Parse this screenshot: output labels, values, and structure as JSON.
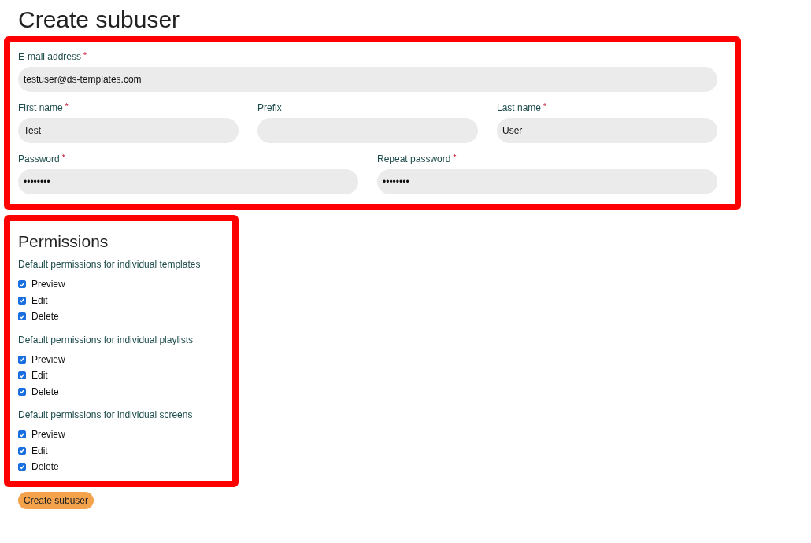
{
  "title": "Create subuser",
  "account": {
    "rows": [
      {
        "fields": [
          {
            "label": "E-mail address",
            "required_mark": "*",
            "value": "testuser@ds-templates.com"
          }
        ]
      },
      {
        "fields": [
          {
            "label": "First name",
            "required_mark": "*",
            "value": "Test"
          },
          {
            "label": "Prefix"
          },
          {
            "label": "Last name",
            "required_mark": "*",
            "value": "User"
          }
        ]
      },
      {
        "fields": [
          {
            "label": "Password",
            "required_mark": "*",
            "value": "••••••••"
          },
          {
            "label": "Repeat password",
            "required_mark": "*",
            "value": "••••••••"
          }
        ]
      }
    ]
  },
  "permissions": {
    "title": "Permissions",
    "groups": [
      {
        "title": "Default permissions for individual templates",
        "options": [
          {
            "label": "Preview",
            "checked": true
          },
          {
            "label": "Edit",
            "checked": true
          },
          {
            "label": "Delete",
            "checked": true
          }
        ]
      },
      {
        "title": "Default permissions for individual playlists",
        "options": [
          {
            "label": "Preview",
            "checked": true
          },
          {
            "label": "Edit",
            "checked": true
          },
          {
            "label": "Delete",
            "checked": true
          }
        ]
      },
      {
        "title": "Default permissions for individual screens",
        "options": [
          {
            "label": "Preview",
            "checked": true
          },
          {
            "label": "Edit",
            "checked": true
          },
          {
            "label": "Delete",
            "checked": true
          }
        ]
      }
    ]
  },
  "submit": "Create subuser"
}
